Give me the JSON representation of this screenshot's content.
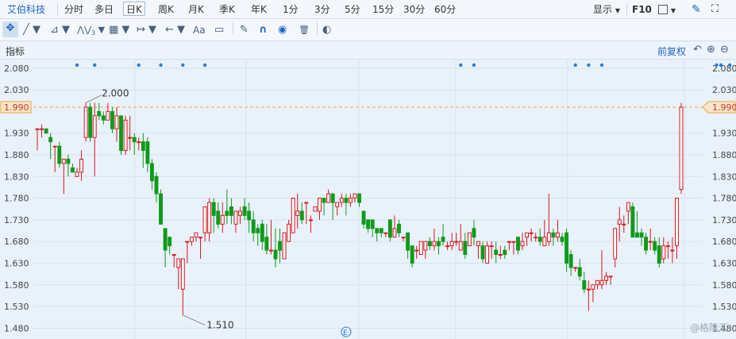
{
  "toolbar": {
    "stock_name": "艾伯科技",
    "periods": [
      "分时",
      "多日",
      "日K",
      "周K",
      "月K",
      "季K",
      "年K",
      "1分",
      "3分",
      "5分",
      "15分",
      "30分",
      "60分"
    ],
    "active_period": "日K",
    "display_label": "显示",
    "f10_label": "F10"
  },
  "tools": {
    "move_icon": "✥",
    "line_icon": "╱",
    "channel_icon": "⊿",
    "wave_icon": "⋀⋁",
    "wave_sub": "3",
    "fib_icon": "▦",
    "range_icon": "↦",
    "arrow_icon": "←",
    "text_label": "Aa",
    "comment_icon": "▭",
    "pen_icon": "✎",
    "magnet_icon": "∩",
    "eye_icon": "◉",
    "trash_icon": "🗑",
    "toggle_icon": "◐"
  },
  "panel": {
    "indicator_label": "指标",
    "adjust_label": "前复权",
    "undo_icon": "↶",
    "zoom_in_icon": "⊕",
    "zoom_out_icon": "⊖"
  },
  "watermark": "@格隆汇",
  "event_marker": "E",
  "chart_data": {
    "type": "candlestick",
    "ylim": [
      1.455,
      2.098
    ],
    "yticks": [
      "2.080",
      "2.030",
      "1.990",
      "1.930",
      "1.880",
      "1.830",
      "1.780",
      "1.730",
      "1.680",
      "1.630",
      "1.580",
      "1.530",
      "1.480"
    ],
    "current_price": 1.99,
    "current_price_label": "1.990",
    "high_annotation": "2.000",
    "low_annotation": "1.510",
    "up_color": "#d8151b",
    "down_color": "#0e9a1b",
    "candles": [
      [
        1.94,
        1.94,
        1.94,
        1.89
      ],
      [
        1.94,
        1.94,
        1.95,
        1.92
      ],
      [
        1.94,
        1.93,
        1.94,
        1.93
      ],
      [
        1.92,
        1.91,
        1.93,
        1.87
      ],
      [
        1.9,
        1.9,
        1.9,
        1.84
      ],
      [
        1.9,
        1.86,
        1.91,
        1.85
      ],
      [
        1.86,
        1.87,
        1.87,
        1.79
      ],
      [
        1.87,
        1.86,
        1.88,
        1.83
      ],
      [
        1.85,
        1.84,
        1.86,
        1.84
      ],
      [
        1.83,
        1.84,
        1.85,
        1.83
      ],
      [
        1.84,
        1.87,
        1.89,
        1.82
      ],
      [
        1.92,
        1.99,
        2.0,
        1.91
      ],
      [
        1.99,
        1.92,
        2.0,
        1.91
      ],
      [
        1.92,
        1.97,
        2.0,
        1.83
      ],
      [
        1.98,
        1.97,
        2.0,
        1.96
      ],
      [
        1.97,
        1.96,
        1.98,
        1.95
      ],
      [
        1.96,
        1.98,
        2.0,
        1.96
      ],
      [
        1.98,
        1.94,
        1.99,
        1.93
      ],
      [
        1.94,
        1.97,
        1.99,
        1.91
      ],
      [
        1.97,
        1.89,
        1.97,
        1.88
      ],
      [
        1.89,
        1.96,
        1.97,
        1.88
      ],
      [
        1.92,
        1.92,
        1.97,
        1.89
      ],
      [
        1.92,
        1.91,
        1.93,
        1.88
      ],
      [
        1.91,
        1.91,
        1.92,
        1.89
      ],
      [
        1.91,
        1.89,
        1.93,
        1.85
      ],
      [
        1.91,
        1.86,
        1.92,
        1.84
      ],
      [
        1.86,
        1.82,
        1.87,
        1.8
      ],
      [
        1.83,
        1.79,
        1.84,
        1.77
      ],
      [
        1.79,
        1.72,
        1.8,
        1.72
      ],
      [
        1.71,
        1.66,
        1.71,
        1.62
      ],
      [
        1.69,
        1.67,
        1.69,
        1.65
      ],
      [
        1.65,
        1.65,
        1.65,
        1.62
      ],
      [
        1.62,
        1.64,
        1.64,
        1.57
      ],
      [
        1.57,
        1.64,
        1.64,
        1.51
      ],
      [
        1.68,
        1.68,
        1.68,
        1.63
      ],
      [
        1.68,
        1.69,
        1.69,
        1.67
      ],
      [
        1.69,
        1.7,
        1.7,
        1.68
      ],
      [
        1.69,
        1.69,
        1.69,
        1.64
      ],
      [
        1.7,
        1.76,
        1.76,
        1.68
      ],
      [
        1.7,
        1.77,
        1.78,
        1.68
      ],
      [
        1.77,
        1.74,
        1.78,
        1.7
      ],
      [
        1.75,
        1.72,
        1.77,
        1.71
      ],
      [
        1.72,
        1.74,
        1.77,
        1.7
      ],
      [
        1.75,
        1.74,
        1.8,
        1.72
      ],
      [
        1.76,
        1.74,
        1.78,
        1.72
      ],
      [
        1.72,
        1.75,
        1.75,
        1.7
      ],
      [
        1.74,
        1.75,
        1.76,
        1.72
      ],
      [
        1.76,
        1.74,
        1.78,
        1.73
      ],
      [
        1.75,
        1.73,
        1.77,
        1.7
      ],
      [
        1.73,
        1.7,
        1.75,
        1.68
      ],
      [
        1.71,
        1.7,
        1.72,
        1.67
      ],
      [
        1.72,
        1.68,
        1.73,
        1.66
      ],
      [
        1.69,
        1.66,
        1.72,
        1.65
      ],
      [
        1.66,
        1.66,
        1.73,
        1.65
      ],
      [
        1.66,
        1.64,
        1.71,
        1.62
      ],
      [
        1.68,
        1.66,
        1.71,
        1.63
      ],
      [
        1.64,
        1.7,
        1.7,
        1.64
      ],
      [
        1.68,
        1.72,
        1.73,
        1.68
      ],
      [
        1.7,
        1.78,
        1.78,
        1.7
      ],
      [
        1.74,
        1.75,
        1.79,
        1.71
      ],
      [
        1.75,
        1.73,
        1.77,
        1.72
      ],
      [
        1.77,
        1.77,
        1.77,
        1.72
      ],
      [
        1.73,
        1.73,
        1.74,
        1.7
      ],
      [
        1.75,
        1.76,
        1.76,
        1.75
      ],
      [
        1.75,
        1.78,
        1.78,
        1.73
      ],
      [
        1.78,
        1.77,
        1.78,
        1.74
      ],
      [
        1.77,
        1.79,
        1.8,
        1.77
      ],
      [
        1.79,
        1.77,
        1.79,
        1.73
      ],
      [
        1.76,
        1.77,
        1.77,
        1.74
      ],
      [
        1.77,
        1.78,
        1.79,
        1.76
      ],
      [
        1.78,
        1.77,
        1.79,
        1.74
      ],
      [
        1.77,
        1.78,
        1.79,
        1.76
      ],
      [
        1.78,
        1.79,
        1.79,
        1.77
      ],
      [
        1.79,
        1.77,
        1.79,
        1.76
      ],
      [
        1.75,
        1.72,
        1.75,
        1.71
      ],
      [
        1.73,
        1.71,
        1.73,
        1.7
      ],
      [
        1.73,
        1.71,
        1.73,
        1.69
      ],
      [
        1.71,
        1.7,
        1.71,
        1.68
      ],
      [
        1.71,
        1.7,
        1.71,
        1.69
      ],
      [
        1.7,
        1.7,
        1.7,
        1.69
      ],
      [
        1.73,
        1.69,
        1.73,
        1.68
      ],
      [
        1.69,
        1.71,
        1.74,
        1.69
      ],
      [
        1.72,
        1.7,
        1.73,
        1.69
      ],
      [
        1.69,
        1.69,
        1.69,
        1.68
      ],
      [
        1.7,
        1.66,
        1.7,
        1.64
      ],
      [
        1.67,
        1.63,
        1.67,
        1.62
      ],
      [
        1.66,
        1.66,
        1.67,
        1.64
      ],
      [
        1.65,
        1.68,
        1.68,
        1.65
      ],
      [
        1.66,
        1.68,
        1.68,
        1.64
      ],
      [
        1.68,
        1.67,
        1.69,
        1.66
      ],
      [
        1.67,
        1.68,
        1.71,
        1.66
      ],
      [
        1.68,
        1.67,
        1.69,
        1.65
      ],
      [
        1.69,
        1.68,
        1.72,
        1.67
      ],
      [
        1.67,
        1.67,
        1.68,
        1.66
      ],
      [
        1.67,
        1.68,
        1.7,
        1.66
      ],
      [
        1.68,
        1.68,
        1.7,
        1.67
      ],
      [
        1.66,
        1.68,
        1.72,
        1.66
      ],
      [
        1.68,
        1.65,
        1.7,
        1.64
      ],
      [
        1.67,
        1.7,
        1.7,
        1.67
      ],
      [
        1.71,
        1.69,
        1.73,
        1.67
      ],
      [
        1.67,
        1.68,
        1.68,
        1.64
      ],
      [
        1.67,
        1.64,
        1.68,
        1.63
      ],
      [
        1.63,
        1.67,
        1.68,
        1.63
      ],
      [
        1.67,
        1.67,
        1.68,
        1.64
      ],
      [
        1.66,
        1.65,
        1.68,
        1.63
      ],
      [
        1.65,
        1.65,
        1.67,
        1.64
      ],
      [
        1.66,
        1.65,
        1.67,
        1.64
      ],
      [
        1.68,
        1.68,
        1.68,
        1.66
      ],
      [
        1.68,
        1.68,
        1.68,
        1.65
      ],
      [
        1.69,
        1.66,
        1.69,
        1.65
      ],
      [
        1.67,
        1.68,
        1.7,
        1.66
      ],
      [
        1.69,
        1.7,
        1.7,
        1.67
      ],
      [
        1.7,
        1.7,
        1.71,
        1.68
      ],
      [
        1.69,
        1.69,
        1.7,
        1.68
      ],
      [
        1.69,
        1.68,
        1.71,
        1.67
      ],
      [
        1.67,
        1.69,
        1.73,
        1.67
      ],
      [
        1.68,
        1.7,
        1.79,
        1.67
      ],
      [
        1.7,
        1.69,
        1.71,
        1.67
      ],
      [
        1.69,
        1.7,
        1.73,
        1.68
      ],
      [
        1.69,
        1.68,
        1.7,
        1.67
      ],
      [
        1.7,
        1.63,
        1.71,
        1.61
      ],
      [
        1.65,
        1.62,
        1.66,
        1.6
      ],
      [
        1.62,
        1.62,
        1.62,
        1.61
      ],
      [
        1.62,
        1.6,
        1.64,
        1.59
      ],
      [
        1.59,
        1.57,
        1.61,
        1.56
      ],
      [
        1.57,
        1.57,
        1.59,
        1.52
      ],
      [
        1.57,
        1.58,
        1.58,
        1.54
      ],
      [
        1.58,
        1.59,
        1.59,
        1.57
      ],
      [
        1.58,
        1.59,
        1.66,
        1.57
      ],
      [
        1.59,
        1.6,
        1.61,
        1.58
      ],
      [
        1.6,
        1.6,
        1.6,
        1.58
      ],
      [
        1.64,
        1.71,
        1.71,
        1.62
      ],
      [
        1.72,
        1.73,
        1.76,
        1.68
      ],
      [
        1.72,
        1.72,
        1.74,
        1.7
      ],
      [
        1.75,
        1.77,
        1.77,
        1.72
      ],
      [
        1.76,
        1.69,
        1.77,
        1.69
      ],
      [
        1.7,
        1.69,
        1.75,
        1.69
      ],
      [
        1.7,
        1.69,
        1.71,
        1.67
      ],
      [
        1.69,
        1.66,
        1.7,
        1.65
      ],
      [
        1.68,
        1.68,
        1.71,
        1.66
      ],
      [
        1.68,
        1.66,
        1.69,
        1.65
      ],
      [
        1.67,
        1.63,
        1.69,
        1.62
      ],
      [
        1.64,
        1.67,
        1.69,
        1.63
      ],
      [
        1.67,
        1.67,
        1.68,
        1.64
      ],
      [
        1.66,
        1.66,
        1.69,
        1.63
      ],
      [
        1.67,
        1.78,
        1.78,
        1.64
      ],
      [
        1.8,
        1.99,
        2.0,
        1.79
      ]
    ],
    "event_dots": [
      9,
      13,
      23,
      28,
      33,
      38,
      96,
      99,
      122,
      125,
      128,
      154,
      155,
      157,
      160,
      166
    ]
  }
}
